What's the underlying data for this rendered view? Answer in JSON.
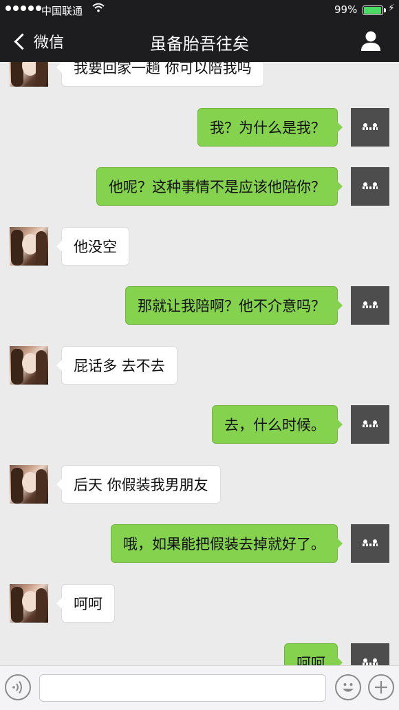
{
  "status_bar": {
    "carrier": "中国联通",
    "battery_pct": "99%",
    "battery_level": 0.99,
    "signal_dots": 5
  },
  "nav": {
    "back_label": "微信",
    "title": "虽备胎吾往矣"
  },
  "messages": [
    {
      "side": "in",
      "text": "我要回家一趟 你可以陪我吗"
    },
    {
      "side": "out",
      "text": "我？为什么是我？"
    },
    {
      "side": "out",
      "text": "他呢？这种事情不是应该他陪你？"
    },
    {
      "side": "in",
      "text": "他没空"
    },
    {
      "side": "out",
      "text": "那就让我陪啊？他不介意吗？"
    },
    {
      "side": "in",
      "text": "屁话多 去不去"
    },
    {
      "side": "out",
      "text": "去，什么时候。"
    },
    {
      "side": "in",
      "text": "后天 你假装我男朋友"
    },
    {
      "side": "out",
      "text": "哦，如果能把假装去掉就好了。"
    },
    {
      "side": "in",
      "text": "呵呵"
    },
    {
      "side": "out",
      "text": "呵呵"
    }
  ],
  "composer": {
    "input_value": ""
  },
  "colors": {
    "nav_bg": "#1d1d1f",
    "chat_bg": "#ebebeb",
    "outgoing_bubble": "#85d24f",
    "incoming_bubble": "#ffffff"
  }
}
